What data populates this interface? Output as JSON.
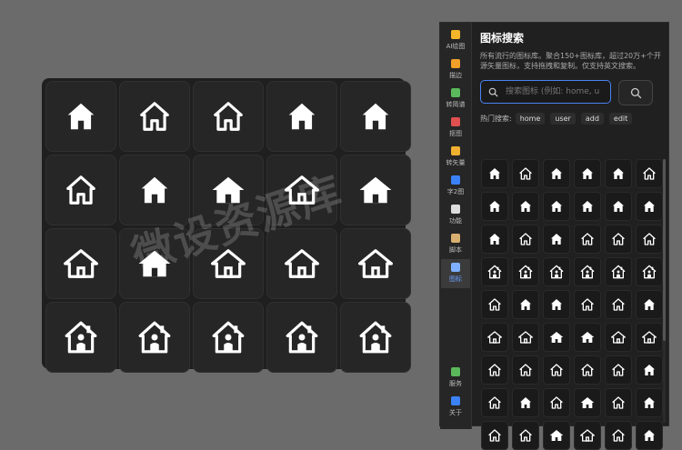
{
  "watermark": "微设资源库",
  "preview": {
    "icons": [
      "house-solid-icon",
      "house-outline-icon",
      "house-outline-icon",
      "house-solid-icon",
      "house-solid-icon",
      "house-outline-icon",
      "house-solid-icon",
      "house-roof-solid-icon",
      "house-roof-outline-icon",
      "house-roof-solid-icon",
      "house-roof-outline-icon",
      "house-roof-solid-icon",
      "house-roof-outline-icon",
      "house-roof-outline-icon",
      "house-roof-outline-icon",
      "house-person-icon",
      "house-person-icon",
      "house-person-icon",
      "house-person-icon",
      "house-person-icon"
    ]
  },
  "toolbar": {
    "items": [
      {
        "label": "AI绘图",
        "icon": "palette-icon",
        "color": "#f5b52a"
      },
      {
        "label": "描边",
        "icon": "pencil-icon",
        "color": "#f0a028"
      },
      {
        "label": "转简谱",
        "icon": "image-icon",
        "color": "#5bb85b"
      },
      {
        "label": "抠图",
        "icon": "scissors-icon",
        "color": "#e05050"
      },
      {
        "label": "转矢量",
        "icon": "ruler-icon",
        "color": "#f0b030"
      },
      {
        "label": "字2图",
        "icon": "text-image-icon",
        "color": "#3b82f6"
      },
      {
        "label": "功能",
        "icon": "gear-icon",
        "color": "#dddddd"
      },
      {
        "label": "脚本",
        "icon": "scroll-icon",
        "color": "#d9b070"
      },
      {
        "label": "图标",
        "icon": "magnifier-icon",
        "color": "#7fb0ff",
        "active": true
      }
    ],
    "bottom": [
      {
        "label": "服务",
        "icon": "monitor-icon",
        "color": "#5bb85b"
      },
      {
        "label": "关于",
        "icon": "info-icon",
        "color": "#3b82f6"
      }
    ]
  },
  "panel": {
    "title": "图标搜索",
    "description": "所有流行的图标库。聚合150+图标库，超过20万+个开源矢量图标，支持拖拽和复制。仅支持英文搜索。",
    "search": {
      "placeholder": "搜索图标 (例如: home, u"
    },
    "hot_label": "热门搜索:",
    "hot_tags": [
      "home",
      "user",
      "add",
      "edit"
    ]
  },
  "results": {
    "icons": [
      "house-solid-icon",
      "house-outline-icon",
      "house-solid-icon",
      "house-solid-icon",
      "house-solid-icon",
      "house-outline-icon",
      "house-solid-icon",
      "house-solid-icon",
      "house-solid-icon",
      "house-solid-icon",
      "house-solid-icon",
      "house-solid-icon",
      "house-solid-icon",
      "house-outline-icon",
      "house-solid-icon",
      "house-outline-icon",
      "house-outline-icon",
      "house-outline-icon",
      "house-person-icon",
      "house-person-icon",
      "house-person-icon",
      "house-person-icon",
      "house-person-icon",
      "house-person-icon",
      "house-outline-icon",
      "house-solid-icon",
      "house-solid-icon",
      "house-outline-icon",
      "house-outline-icon",
      "house-solid-icon",
      "house-roof-outline-icon",
      "house-roof-outline-icon",
      "house-roof-solid-icon",
      "house-roof-solid-icon",
      "house-roof-outline-icon",
      "house-roof-outline-icon",
      "house-outline-icon",
      "house-outline-icon",
      "house-outline-icon",
      "house-outline-icon",
      "house-outline-icon",
      "house-solid-icon",
      "house-outline-icon",
      "house-solid-icon",
      "house-outline-icon",
      "house-roof-solid-icon",
      "house-outline-icon",
      "house-solid-icon",
      "house-outline-icon",
      "house-outline-icon",
      "house-roof-solid-icon",
      "house-roof-outline-icon",
      "house-outline-icon",
      "house-solid-icon"
    ]
  }
}
